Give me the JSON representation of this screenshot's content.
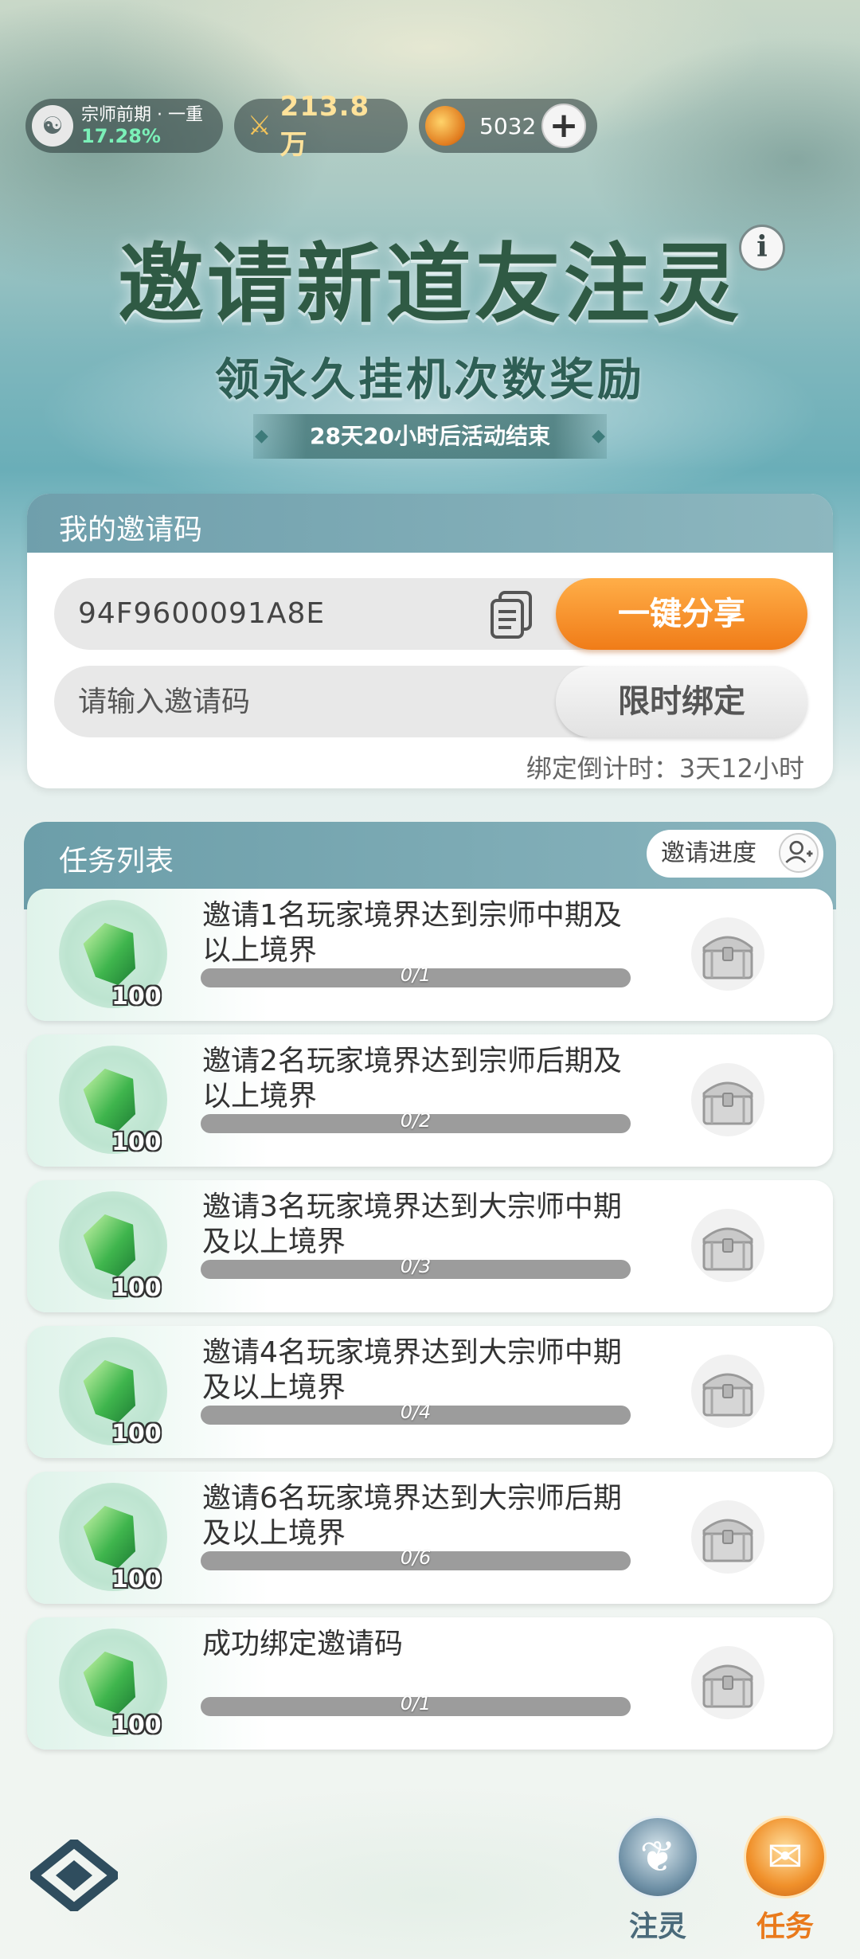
{
  "status": {
    "rank_title": "宗师前期 · 一重",
    "rank_progress": "17.28%",
    "power": "213.8万",
    "currency": "5032",
    "plus": "+"
  },
  "header": {
    "title": "邀请新道友注灵",
    "info": "i",
    "subtitle": "领永久挂机次数奖励",
    "countdown": "28天20小时后活动结束"
  },
  "invite": {
    "section_title": "我的邀请码",
    "code": "94F9600091A8E",
    "share_button": "一键分享",
    "input_placeholder": "请输入邀请码",
    "bind_button": "限时绑定",
    "bind_countdown": "绑定倒计时：3天12小时"
  },
  "tasks": {
    "section_title": "任务列表",
    "progress_button": "邀请进度",
    "items": [
      {
        "title": "邀请1名玩家境界达到宗师中期及以上境界",
        "progress": "0/1",
        "fraction": 0,
        "reward_qty": "100"
      },
      {
        "title": "邀请2名玩家境界达到宗师后期及以上境界",
        "progress": "0/2",
        "fraction": 0,
        "reward_qty": "100"
      },
      {
        "title": "邀请3名玩家境界达到大宗师中期及以上境界",
        "progress": "0/3",
        "fraction": 0,
        "reward_qty": "100"
      },
      {
        "title": "邀请4名玩家境界达到大宗师中期及以上境界",
        "progress": "0/4",
        "fraction": 0,
        "reward_qty": "100"
      },
      {
        "title": "邀请6名玩家境界达到大宗师后期及以上境界",
        "progress": "0/6",
        "fraction": 0,
        "reward_qty": "100"
      },
      {
        "title": "成功绑定邀请码",
        "progress": "0/1",
        "fraction": 0,
        "reward_qty": "100"
      }
    ]
  },
  "nav": {
    "spirit_label": "注灵",
    "task_label": "任务"
  },
  "icons": {
    "reward": "green-jade-icon",
    "chest": "treasure-chest-icon",
    "copy": "copy-icon",
    "person_add": "person-add-icon",
    "power": "swords-icon",
    "coin": "coin-icon",
    "logo": "game-logo-icon"
  },
  "colors": {
    "accent": "#f07c18",
    "header_teal": "#6f9fac",
    "progress_green": "#7bf0b8"
  }
}
